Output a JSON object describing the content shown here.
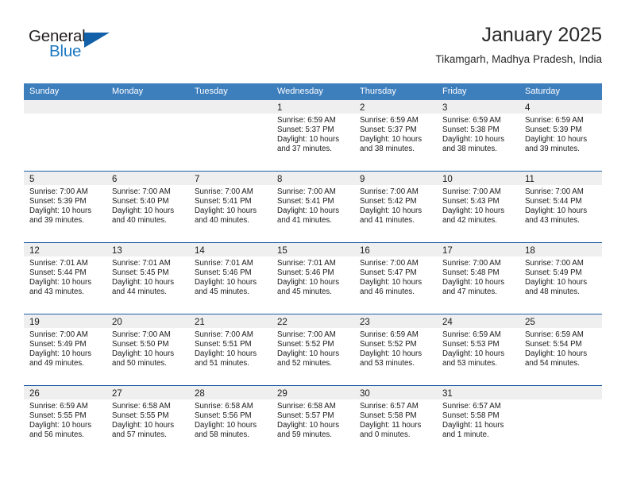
{
  "brand": {
    "name_top": "General",
    "name_bottom": "Blue",
    "accent_color": "#1261a8",
    "blue_text_color": "#1b78c2"
  },
  "header": {
    "title": "January 2025",
    "subtitle": "Tikamgarh, Madhya Pradesh, India"
  },
  "calendar": {
    "header_bg": "#3d7ebd",
    "week_separator_color": "#1f5fa6",
    "day_band_bg": "#efefef",
    "weekdays": [
      "Sunday",
      "Monday",
      "Tuesday",
      "Wednesday",
      "Thursday",
      "Friday",
      "Saturday"
    ],
    "weeks": [
      [
        {
          "day": "",
          "empty": true
        },
        {
          "day": "",
          "empty": true
        },
        {
          "day": "",
          "empty": true
        },
        {
          "day": "1",
          "sunrise": "Sunrise: 6:59 AM",
          "sunset": "Sunset: 5:37 PM",
          "daylight1": "Daylight: 10 hours",
          "daylight2": "and 37 minutes."
        },
        {
          "day": "2",
          "sunrise": "Sunrise: 6:59 AM",
          "sunset": "Sunset: 5:37 PM",
          "daylight1": "Daylight: 10 hours",
          "daylight2": "and 38 minutes."
        },
        {
          "day": "3",
          "sunrise": "Sunrise: 6:59 AM",
          "sunset": "Sunset: 5:38 PM",
          "daylight1": "Daylight: 10 hours",
          "daylight2": "and 38 minutes."
        },
        {
          "day": "4",
          "sunrise": "Sunrise: 6:59 AM",
          "sunset": "Sunset: 5:39 PM",
          "daylight1": "Daylight: 10 hours",
          "daylight2": "and 39 minutes."
        }
      ],
      [
        {
          "day": "5",
          "sunrise": "Sunrise: 7:00 AM",
          "sunset": "Sunset: 5:39 PM",
          "daylight1": "Daylight: 10 hours",
          "daylight2": "and 39 minutes."
        },
        {
          "day": "6",
          "sunrise": "Sunrise: 7:00 AM",
          "sunset": "Sunset: 5:40 PM",
          "daylight1": "Daylight: 10 hours",
          "daylight2": "and 40 minutes."
        },
        {
          "day": "7",
          "sunrise": "Sunrise: 7:00 AM",
          "sunset": "Sunset: 5:41 PM",
          "daylight1": "Daylight: 10 hours",
          "daylight2": "and 40 minutes."
        },
        {
          "day": "8",
          "sunrise": "Sunrise: 7:00 AM",
          "sunset": "Sunset: 5:41 PM",
          "daylight1": "Daylight: 10 hours",
          "daylight2": "and 41 minutes."
        },
        {
          "day": "9",
          "sunrise": "Sunrise: 7:00 AM",
          "sunset": "Sunset: 5:42 PM",
          "daylight1": "Daylight: 10 hours",
          "daylight2": "and 41 minutes."
        },
        {
          "day": "10",
          "sunrise": "Sunrise: 7:00 AM",
          "sunset": "Sunset: 5:43 PM",
          "daylight1": "Daylight: 10 hours",
          "daylight2": "and 42 minutes."
        },
        {
          "day": "11",
          "sunrise": "Sunrise: 7:00 AM",
          "sunset": "Sunset: 5:44 PM",
          "daylight1": "Daylight: 10 hours",
          "daylight2": "and 43 minutes."
        }
      ],
      [
        {
          "day": "12",
          "sunrise": "Sunrise: 7:01 AM",
          "sunset": "Sunset: 5:44 PM",
          "daylight1": "Daylight: 10 hours",
          "daylight2": "and 43 minutes."
        },
        {
          "day": "13",
          "sunrise": "Sunrise: 7:01 AM",
          "sunset": "Sunset: 5:45 PM",
          "daylight1": "Daylight: 10 hours",
          "daylight2": "and 44 minutes."
        },
        {
          "day": "14",
          "sunrise": "Sunrise: 7:01 AM",
          "sunset": "Sunset: 5:46 PM",
          "daylight1": "Daylight: 10 hours",
          "daylight2": "and 45 minutes."
        },
        {
          "day": "15",
          "sunrise": "Sunrise: 7:01 AM",
          "sunset": "Sunset: 5:46 PM",
          "daylight1": "Daylight: 10 hours",
          "daylight2": "and 45 minutes."
        },
        {
          "day": "16",
          "sunrise": "Sunrise: 7:00 AM",
          "sunset": "Sunset: 5:47 PM",
          "daylight1": "Daylight: 10 hours",
          "daylight2": "and 46 minutes."
        },
        {
          "day": "17",
          "sunrise": "Sunrise: 7:00 AM",
          "sunset": "Sunset: 5:48 PM",
          "daylight1": "Daylight: 10 hours",
          "daylight2": "and 47 minutes."
        },
        {
          "day": "18",
          "sunrise": "Sunrise: 7:00 AM",
          "sunset": "Sunset: 5:49 PM",
          "daylight1": "Daylight: 10 hours",
          "daylight2": "and 48 minutes."
        }
      ],
      [
        {
          "day": "19",
          "sunrise": "Sunrise: 7:00 AM",
          "sunset": "Sunset: 5:49 PM",
          "daylight1": "Daylight: 10 hours",
          "daylight2": "and 49 minutes."
        },
        {
          "day": "20",
          "sunrise": "Sunrise: 7:00 AM",
          "sunset": "Sunset: 5:50 PM",
          "daylight1": "Daylight: 10 hours",
          "daylight2": "and 50 minutes."
        },
        {
          "day": "21",
          "sunrise": "Sunrise: 7:00 AM",
          "sunset": "Sunset: 5:51 PM",
          "daylight1": "Daylight: 10 hours",
          "daylight2": "and 51 minutes."
        },
        {
          "day": "22",
          "sunrise": "Sunrise: 7:00 AM",
          "sunset": "Sunset: 5:52 PM",
          "daylight1": "Daylight: 10 hours",
          "daylight2": "and 52 minutes."
        },
        {
          "day": "23",
          "sunrise": "Sunrise: 6:59 AM",
          "sunset": "Sunset: 5:52 PM",
          "daylight1": "Daylight: 10 hours",
          "daylight2": "and 53 minutes."
        },
        {
          "day": "24",
          "sunrise": "Sunrise: 6:59 AM",
          "sunset": "Sunset: 5:53 PM",
          "daylight1": "Daylight: 10 hours",
          "daylight2": "and 53 minutes."
        },
        {
          "day": "25",
          "sunrise": "Sunrise: 6:59 AM",
          "sunset": "Sunset: 5:54 PM",
          "daylight1": "Daylight: 10 hours",
          "daylight2": "and 54 minutes."
        }
      ],
      [
        {
          "day": "26",
          "sunrise": "Sunrise: 6:59 AM",
          "sunset": "Sunset: 5:55 PM",
          "daylight1": "Daylight: 10 hours",
          "daylight2": "and 56 minutes."
        },
        {
          "day": "27",
          "sunrise": "Sunrise: 6:58 AM",
          "sunset": "Sunset: 5:55 PM",
          "daylight1": "Daylight: 10 hours",
          "daylight2": "and 57 minutes."
        },
        {
          "day": "28",
          "sunrise": "Sunrise: 6:58 AM",
          "sunset": "Sunset: 5:56 PM",
          "daylight1": "Daylight: 10 hours",
          "daylight2": "and 58 minutes."
        },
        {
          "day": "29",
          "sunrise": "Sunrise: 6:58 AM",
          "sunset": "Sunset: 5:57 PM",
          "daylight1": "Daylight: 10 hours",
          "daylight2": "and 59 minutes."
        },
        {
          "day": "30",
          "sunrise": "Sunrise: 6:57 AM",
          "sunset": "Sunset: 5:58 PM",
          "daylight1": "Daylight: 11 hours",
          "daylight2": "and 0 minutes."
        },
        {
          "day": "31",
          "sunrise": "Sunrise: 6:57 AM",
          "sunset": "Sunset: 5:58 PM",
          "daylight1": "Daylight: 11 hours",
          "daylight2": "and 1 minute."
        },
        {
          "day": "",
          "empty": true
        }
      ]
    ]
  }
}
